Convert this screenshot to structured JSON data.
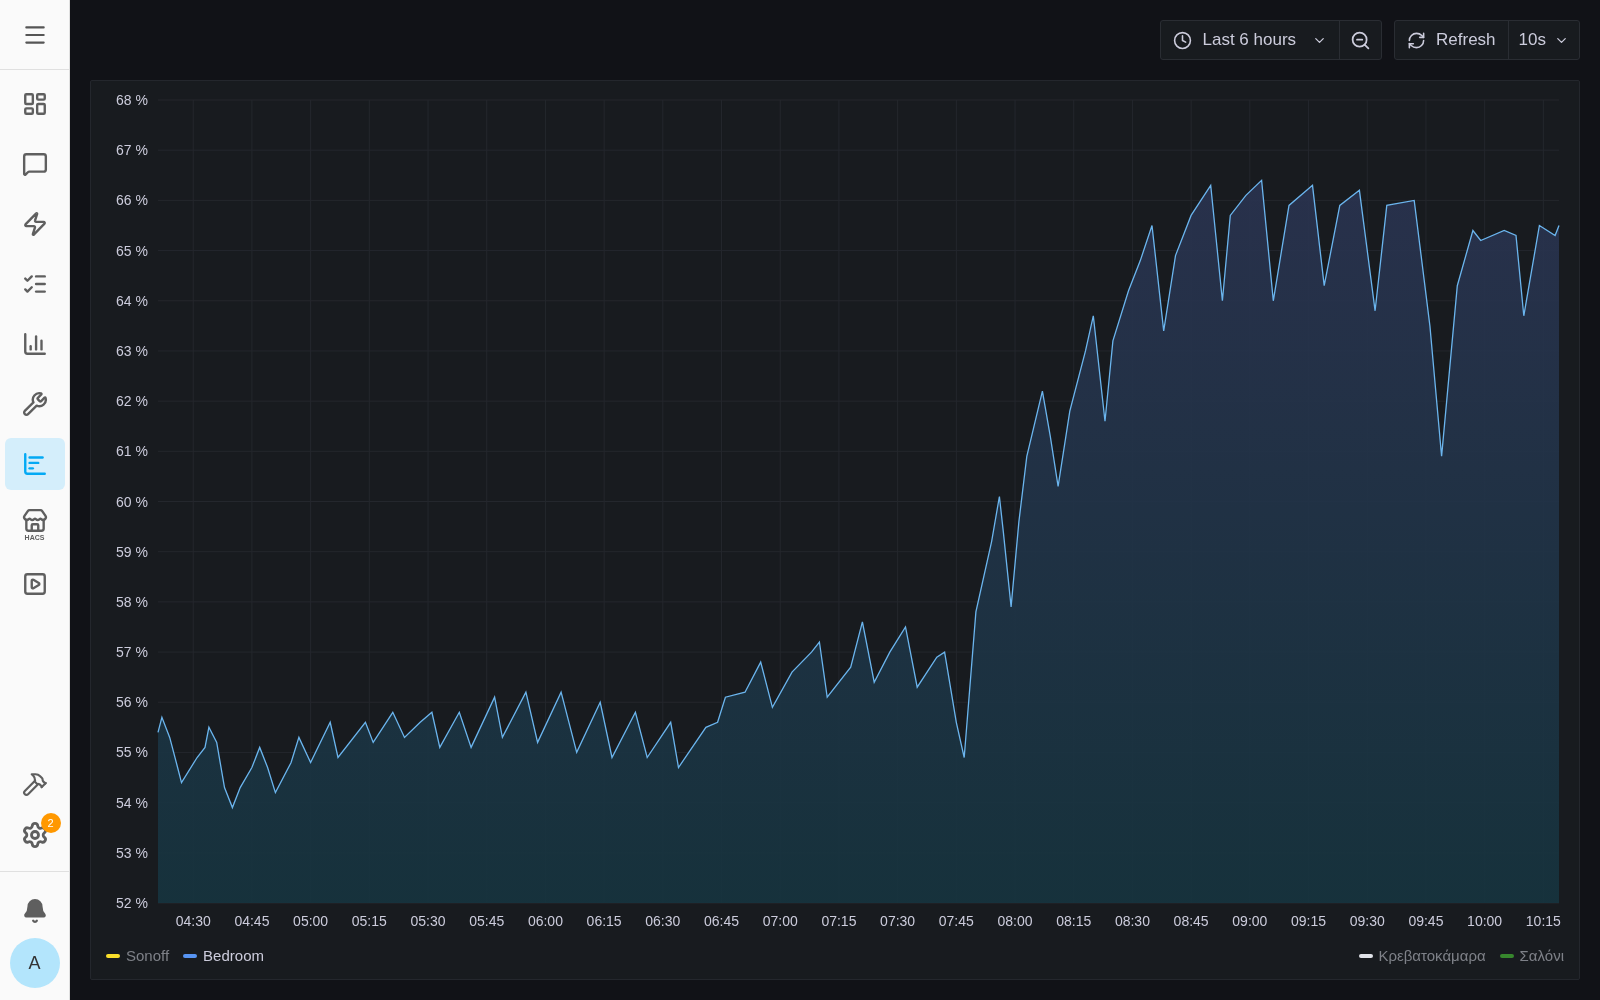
{
  "sidebar": {
    "items": [
      {
        "selected": false
      },
      {
        "selected": false
      },
      {
        "selected": false
      },
      {
        "selected": false
      },
      {
        "selected": false
      },
      {
        "selected": false
      },
      {
        "selected": true
      },
      {
        "selected": false
      },
      {
        "selected": false
      }
    ],
    "hacs_label": "HACS",
    "settings_badge": "2",
    "avatar": "A"
  },
  "toolbar": {
    "time_range": "Last 6 hours",
    "refresh": "Refresh",
    "interval": "10s"
  },
  "panel": {
    "chart_data": {
      "type": "area",
      "grid": true,
      "xlim": [
        261,
        619
      ],
      "ylim": [
        52,
        68
      ],
      "yticks": [
        {
          "value": 52,
          "label": "52 %"
        },
        {
          "value": 53,
          "label": "53 %"
        },
        {
          "value": 54,
          "label": "54 %"
        },
        {
          "value": 55,
          "label": "55 %"
        },
        {
          "value": 56,
          "label": "56 %"
        },
        {
          "value": 57,
          "label": "57 %"
        },
        {
          "value": 58,
          "label": "58 %"
        },
        {
          "value": 59,
          "label": "59 %"
        },
        {
          "value": 60,
          "label": "60 %"
        },
        {
          "value": 61,
          "label": "61 %"
        },
        {
          "value": 62,
          "label": "62 %"
        },
        {
          "value": 63,
          "label": "63 %"
        },
        {
          "value": 64,
          "label": "64 %"
        },
        {
          "value": 65,
          "label": "65 %"
        },
        {
          "value": 66,
          "label": "66 %"
        },
        {
          "value": 67,
          "label": "67 %"
        },
        {
          "value": 68,
          "label": "68 %"
        }
      ],
      "xticks": [
        {
          "value": 270,
          "label": "04:30"
        },
        {
          "value": 285,
          "label": "04:45"
        },
        {
          "value": 300,
          "label": "05:00"
        },
        {
          "value": 315,
          "label": "05:15"
        },
        {
          "value": 330,
          "label": "05:30"
        },
        {
          "value": 345,
          "label": "05:45"
        },
        {
          "value": 360,
          "label": "06:00"
        },
        {
          "value": 375,
          "label": "06:15"
        },
        {
          "value": 390,
          "label": "06:30"
        },
        {
          "value": 405,
          "label": "06:45"
        },
        {
          "value": 420,
          "label": "07:00"
        },
        {
          "value": 435,
          "label": "07:15"
        },
        {
          "value": 450,
          "label": "07:30"
        },
        {
          "value": 465,
          "label": "07:45"
        },
        {
          "value": 480,
          "label": "08:00"
        },
        {
          "value": 495,
          "label": "08:15"
        },
        {
          "value": 510,
          "label": "08:30"
        },
        {
          "value": 525,
          "label": "08:45"
        },
        {
          "value": 540,
          "label": "09:00"
        },
        {
          "value": 555,
          "label": "09:15"
        },
        {
          "value": 570,
          "label": "09:30"
        },
        {
          "value": 585,
          "label": "09:45"
        },
        {
          "value": 600,
          "label": "10:00"
        },
        {
          "value": 615,
          "label": "10:15"
        }
      ],
      "x": [
        261,
        262,
        264,
        266,
        267,
        271,
        273,
        274,
        276,
        278,
        280,
        282,
        285,
        287,
        289,
        291,
        295,
        297,
        300,
        305,
        307,
        314,
        316,
        321,
        324,
        328,
        331,
        333,
        338,
        341,
        347,
        349,
        355,
        358,
        364,
        368,
        374,
        377,
        383,
        386,
        392,
        394,
        401,
        404,
        406,
        411,
        415,
        418,
        423,
        428,
        430,
        432,
        438,
        441,
        444,
        448,
        452,
        455,
        460,
        462,
        465,
        467,
        470,
        474,
        476,
        477,
        479,
        481,
        483,
        487,
        489,
        491,
        494,
        498,
        500,
        503,
        505,
        509,
        512,
        515,
        518,
        521,
        525,
        530,
        533,
        535,
        539,
        543,
        546,
        550,
        556,
        559,
        563,
        568,
        572,
        575,
        582,
        586,
        589,
        593,
        597,
        599,
        605,
        608,
        610,
        614,
        618,
        619
      ],
      "series": [
        {
          "color": "#6bb5ee",
          "values": [
            55.4,
            55.7,
            55.3,
            54.7,
            54.4,
            54.9,
            55.1,
            55.5,
            55.2,
            54.3,
            53.9,
            54.3,
            54.7,
            55.1,
            54.7,
            54.2,
            54.8,
            55.3,
            54.8,
            55.6,
            54.9,
            55.6,
            55.2,
            55.8,
            55.3,
            55.6,
            55.8,
            55.1,
            55.8,
            55.1,
            56.1,
            55.3,
            56.2,
            55.2,
            56.2,
            55.0,
            56.0,
            54.9,
            55.8,
            54.9,
            55.6,
            54.7,
            55.5,
            55.6,
            56.1,
            56.2,
            56.8,
            55.9,
            56.6,
            57.0,
            57.2,
            56.1,
            56.7,
            57.6,
            56.4,
            57.0,
            57.5,
            56.3,
            56.9,
            57.0,
            55.6,
            54.9,
            57.8,
            59.2,
            60.1,
            59.4,
            57.9,
            59.6,
            60.9,
            62.2,
            61.3,
            60.3,
            61.8,
            63.0,
            63.7,
            61.6,
            63.2,
            64.2,
            64.8,
            65.5,
            63.4,
            64.9,
            65.7,
            66.3,
            64.0,
            65.7,
            66.1,
            66.4,
            64.0,
            65.9,
            66.3,
            64.3,
            65.9,
            66.2,
            63.8,
            65.9,
            66.0,
            63.5,
            60.9,
            64.3,
            65.4,
            65.2,
            65.4,
            65.3,
            63.7,
            65.5,
            65.3,
            65.5
          ]
        }
      ]
    },
    "legend": [
      {
        "name": "Sonoff",
        "color": "#fade2a",
        "selected": false
      },
      {
        "name": "Bedroom",
        "color": "#5794f2",
        "selected": true
      },
      {
        "name": "Κρεβατοκάμαρα",
        "color": "#e0e2e8",
        "selected": false
      },
      {
        "name": "Σαλόνι",
        "color": "#37872d",
        "selected": false
      }
    ]
  }
}
